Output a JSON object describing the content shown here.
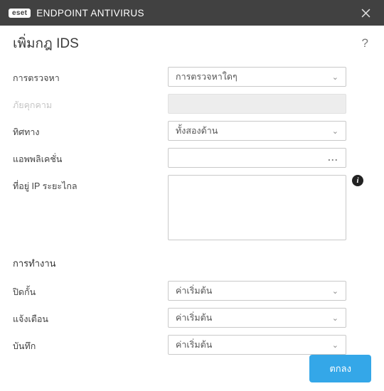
{
  "titlebar": {
    "brand": "eset",
    "title": "ENDPOINT ANTIVIRUS"
  },
  "header": {
    "page_title": "เพิ่มกฎ IDS",
    "help_glyph": "?"
  },
  "form": {
    "detection": {
      "label": "การตรวจหา",
      "value": "การตรวจหาใดๆ"
    },
    "threat": {
      "label": "ภัยคุกคาม",
      "value": ""
    },
    "direction": {
      "label": "ทิศทาง",
      "value": "ทั้งสองด้าน"
    },
    "application": {
      "label": "แอพพลิเคชั่น",
      "value": ""
    },
    "remote_ip": {
      "label": "ที่อยู่ IP ระยะไกล",
      "value": ""
    }
  },
  "section_action": "การทํางาน",
  "actions": {
    "block": {
      "label": "ปิดกั้น",
      "value": "ค่าเริ่มต้น"
    },
    "notify": {
      "label": "แจ้งเตือน",
      "value": "ค่าเริ่มต้น"
    },
    "log": {
      "label": "บันทึก",
      "value": "ค่าเริ่มต้น"
    }
  },
  "footer": {
    "submit": "ตกลง"
  },
  "info_glyph": "i"
}
